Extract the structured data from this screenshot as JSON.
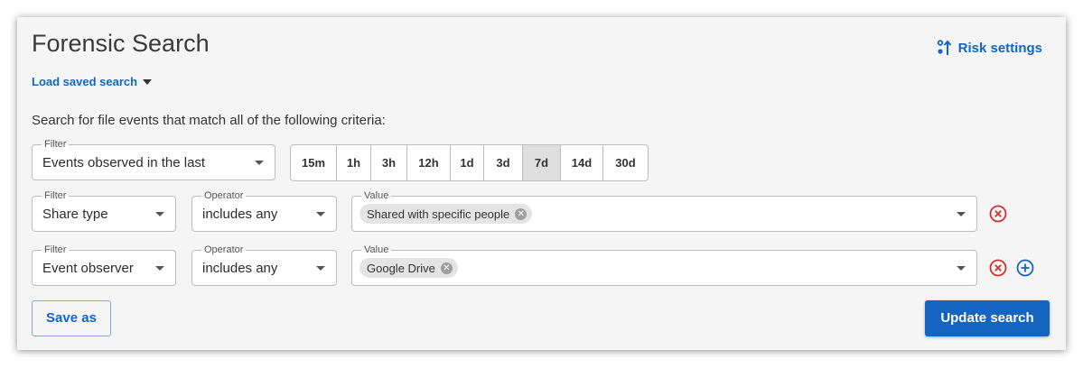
{
  "header": {
    "title": "Forensic Search",
    "risk_settings_label": "Risk settings",
    "load_saved_label": "Load saved search"
  },
  "description": "Search for file events that match all of the following criteria:",
  "rows": [
    {
      "filter_label": "Filter",
      "filter_value": "Events observed in the last",
      "time_ranges": [
        "15m",
        "1h",
        "3h",
        "12h",
        "1d",
        "3d",
        "7d",
        "14d",
        "30d"
      ],
      "selected_range": "7d"
    },
    {
      "filter_label": "Filter",
      "filter_value": "Share type",
      "operator_label": "Operator",
      "operator_value": "includes any",
      "value_label": "Value",
      "chips": [
        "Shared with specific people"
      ]
    },
    {
      "filter_label": "Filter",
      "filter_value": "Event observer",
      "operator_label": "Operator",
      "operator_value": "includes any",
      "value_label": "Value",
      "chips": [
        "Google Drive"
      ]
    }
  ],
  "footer": {
    "save_as_label": "Save as",
    "update_label": "Update search"
  },
  "colors": {
    "accent": "#1565c0",
    "remove": "#d32f2f",
    "selected_segment": "#dedede"
  },
  "icons": {
    "risk": "risk-settings-icon",
    "remove": "remove-circle-icon",
    "add": "add-circle-icon",
    "chip_clear": "chip-clear-icon",
    "dropdown": "chevron-down-icon"
  }
}
